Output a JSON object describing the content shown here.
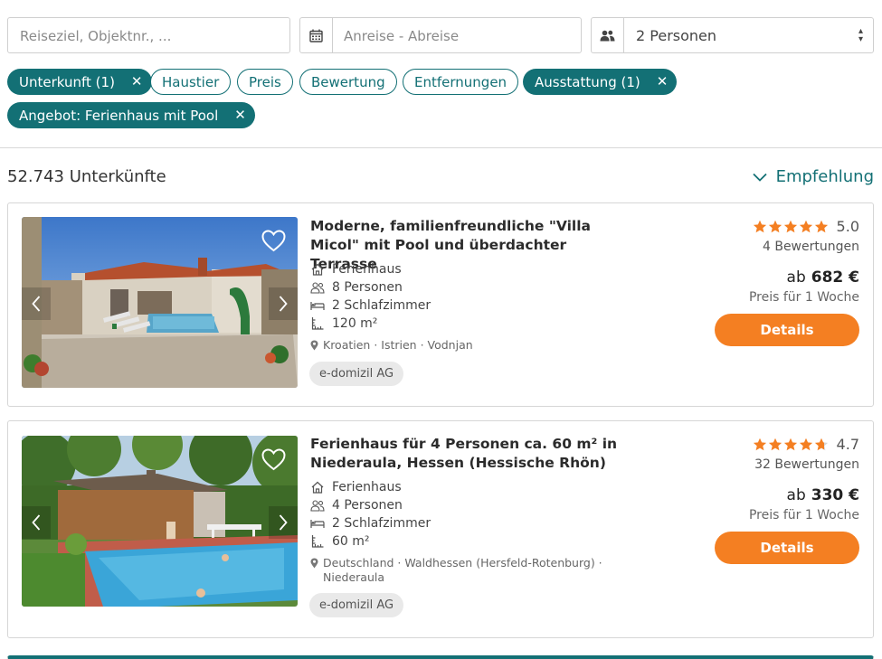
{
  "search": {
    "destination_placeholder": "Reiseziel, Objektnr., ...",
    "dates_placeholder": "Anreise - Abreise",
    "persons_value": "2 Personen"
  },
  "filters": [
    {
      "label": "Unterkunft (1)",
      "active": true
    },
    {
      "label": "Haustier",
      "active": false
    },
    {
      "label": "Preis",
      "active": false
    },
    {
      "label": "Bewertung",
      "active": false
    },
    {
      "label": "Entfernungen",
      "active": false
    },
    {
      "label": "Ausstattung (1)",
      "active": true
    },
    {
      "label": "Angebot: Ferienhaus mit Pool",
      "active": true
    }
  ],
  "results": {
    "count": "52.743 Unterkünfte",
    "sort_label": "Empfehlung"
  },
  "listings": [
    {
      "title": "Moderne, familienfreundliche \"Villa Micol\" mit Pool und überdachter Terrasse",
      "type": "Ferienhaus",
      "persons": "8 Personen",
      "bedrooms": "2 Schlafzimmer",
      "area": "120 m²",
      "location": "Kroatien · Istrien · Vodnjan",
      "provider": "e-domizil AG",
      "rating": "5.0",
      "rating_stars": 5,
      "reviews": "4 Bewertungen",
      "price_prefix": "ab",
      "price": "682 €",
      "price_note": "Preis für 1 Woche",
      "details_label": "Details"
    },
    {
      "title": "Ferienhaus für 4 Personen ca. 60 m² in Niederaula, Hessen (Hessische Rhön)",
      "type": "Ferienhaus",
      "persons": "4 Personen",
      "bedrooms": "2 Schlafzimmer",
      "area": "60 m²",
      "location": "Deutschland · Waldhessen (Hersfeld-Rotenburg) · Niederaula",
      "provider": "e-domizil AG",
      "rating": "4.7",
      "rating_stars": 4.7,
      "reviews": "32 Bewertungen",
      "price_prefix": "ab",
      "price": "330 €",
      "price_note": "Preis für 1 Woche",
      "details_label": "Details"
    }
  ],
  "colors": {
    "accent": "#137075",
    "cta": "#f47f22",
    "star": "#f47f22"
  }
}
